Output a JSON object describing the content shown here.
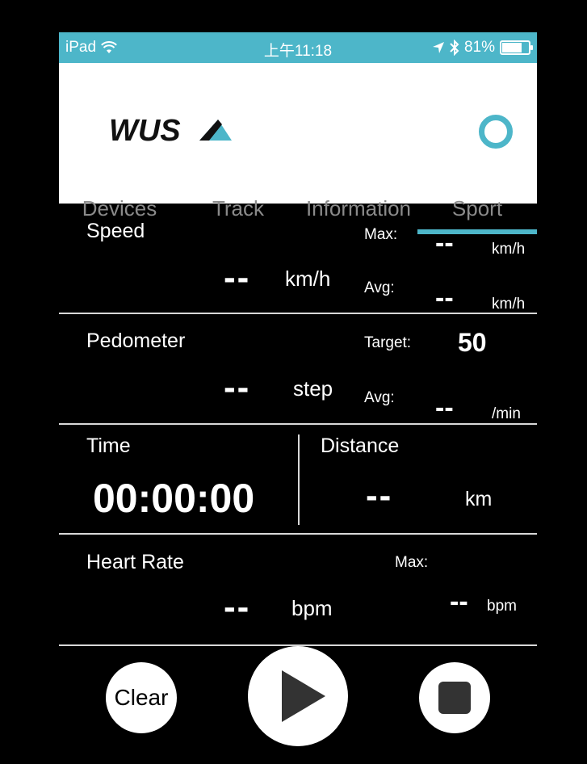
{
  "status_bar": {
    "carrier": "iPad",
    "time": "上午11:18",
    "battery": "81%",
    "battery_level": 0.81
  },
  "header": {
    "logo_text": "WUS",
    "tabs": [
      {
        "label": "Devices",
        "active": false
      },
      {
        "label": "Track",
        "active": false
      },
      {
        "label": "Information",
        "active": false
      },
      {
        "label": "Sport",
        "active": true
      }
    ]
  },
  "speed": {
    "label": "Speed",
    "value": "--",
    "unit": "km/h",
    "max_label": "Max:",
    "max_value": "--",
    "max_unit": "km/h",
    "avg_label": "Avg:",
    "avg_value": "--",
    "avg_unit": "km/h"
  },
  "pedometer": {
    "label": "Pedometer",
    "value": "--",
    "unit": "step",
    "target_label": "Target:",
    "target_value": "50",
    "avg_label": "Avg:",
    "avg_value": "--",
    "avg_unit": "/min"
  },
  "time": {
    "label": "Time",
    "value": "00:00:00"
  },
  "distance": {
    "label": "Distance",
    "value": "--",
    "unit": "km"
  },
  "heart_rate": {
    "label": "Heart Rate",
    "value": "--",
    "unit": "bpm",
    "max_label": "Max:",
    "max_value": "--",
    "max_unit": "bpm"
  },
  "controls": {
    "clear_label": "Clear"
  },
  "colors": {
    "accent": "#4db6c9",
    "tab_text": "#8a8a8a",
    "button_icon": "#333333"
  }
}
